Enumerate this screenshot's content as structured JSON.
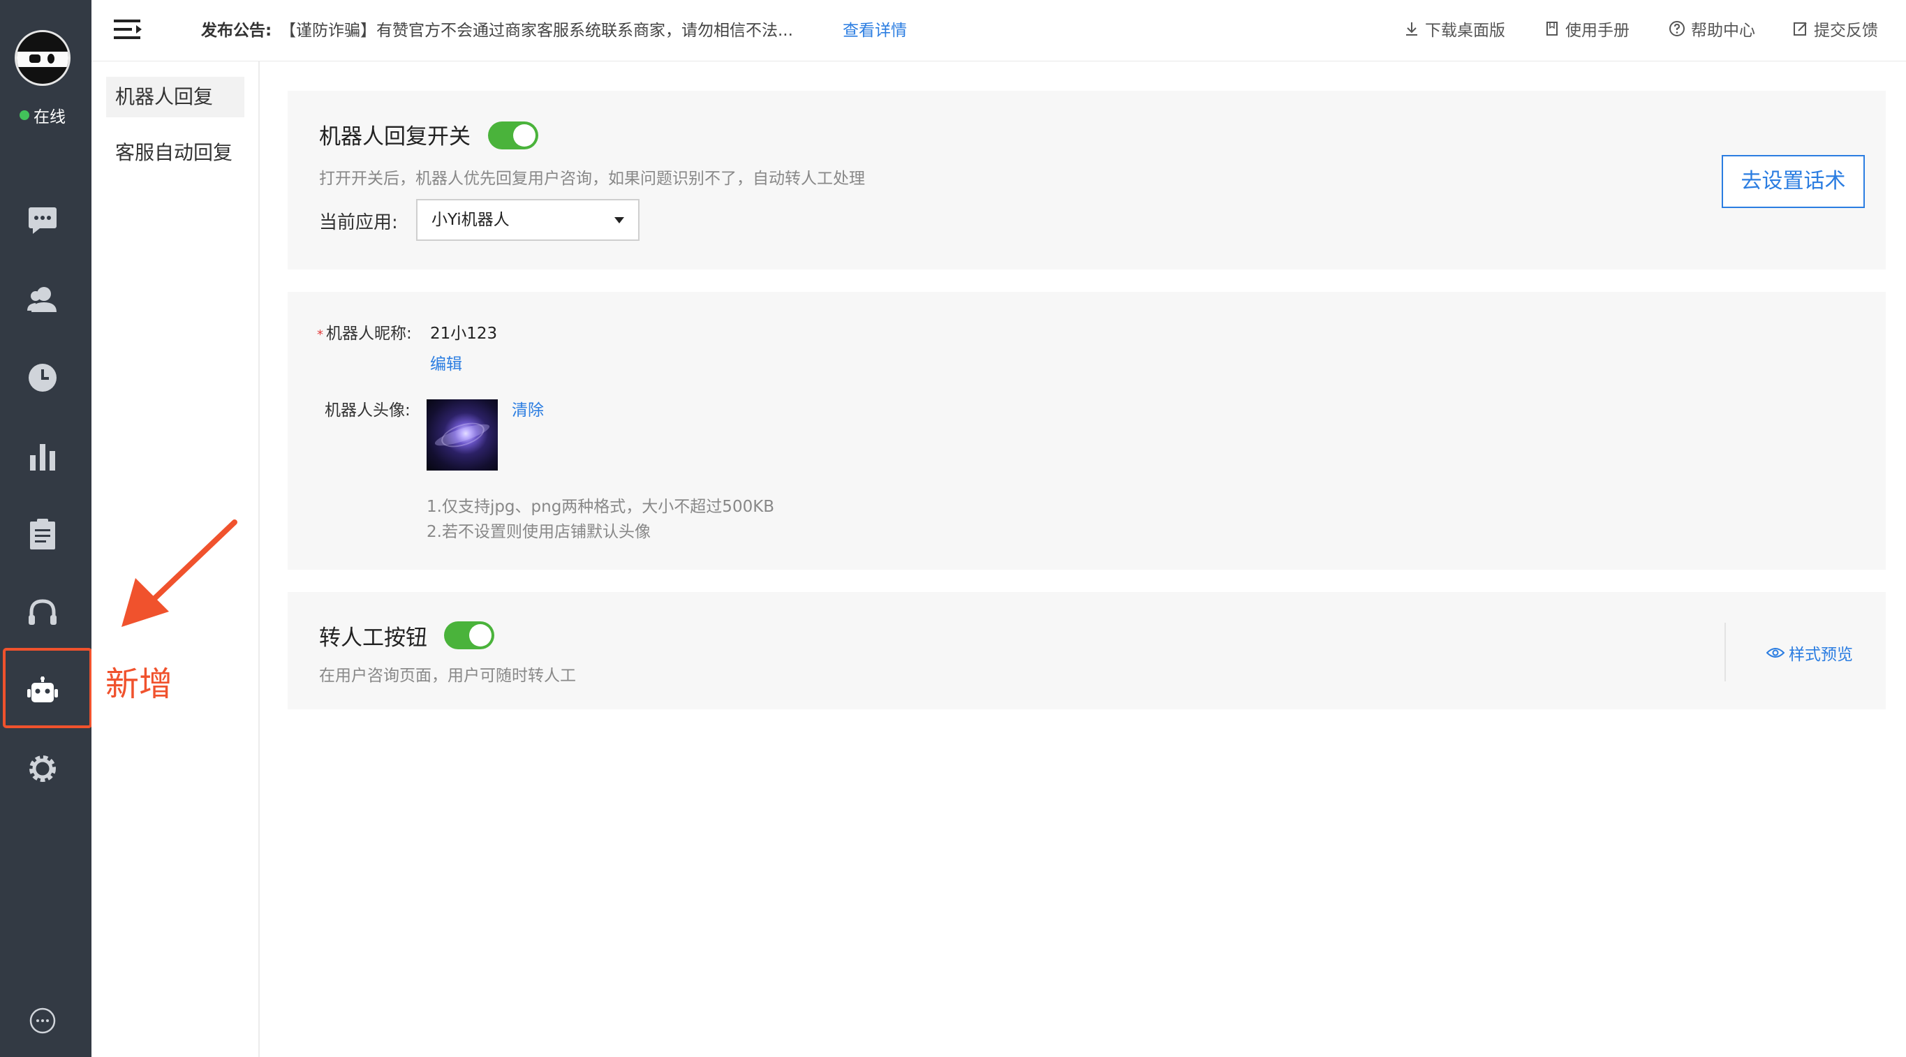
{
  "sidebar": {
    "status": "在线",
    "icons": [
      {
        "name": "chat-icon"
      },
      {
        "name": "customer-icon"
      },
      {
        "name": "history-clock-icon"
      },
      {
        "name": "stats-chart-icon"
      },
      {
        "name": "clipboard-icon"
      },
      {
        "name": "headset-icon"
      },
      {
        "name": "robot-icon"
      },
      {
        "name": "settings-gear-icon"
      },
      {
        "name": "more-icon"
      }
    ]
  },
  "topbar": {
    "notice_label": "发布公告:",
    "notice_text": "【谨防诈骗】有赞官方不会通过商家客服系统联系商家，请勿相信不法...",
    "notice_link": "查看详情",
    "actions": {
      "download": "下载桌面版",
      "manual": "使用手册",
      "help": "帮助中心",
      "feedback": "提交反馈"
    }
  },
  "submenu": {
    "items": [
      {
        "label": "机器人回复",
        "active": true
      },
      {
        "label": "客服自动回复",
        "active": false
      }
    ]
  },
  "annotation": {
    "new_label": "新增",
    "color": "#f0522d"
  },
  "panel_switch": {
    "title": "机器人回复开关",
    "enabled": true,
    "description": "打开开关后，机器人优先回复用户咨询，如果问题识别不了，自动转人工处理",
    "app_label": "当前应用:",
    "app_selected": "小Yi机器人",
    "setup_button": "去设置话术"
  },
  "panel_profile": {
    "nickname_label": "机器人昵称:",
    "nickname_value": "21小123",
    "edit_link": "编辑",
    "avatar_label": "机器人头像:",
    "clear_link": "清除",
    "hint_1": "1.仅支持jpg、png两种格式，大小不超过500KB",
    "hint_2": "2.若不设置则使用店铺默认头像"
  },
  "panel_transfer": {
    "title": "转人工按钮",
    "enabled": true,
    "description": "在用户咨询页面，用户可随时转人工",
    "preview_link": "样式预览"
  },
  "colors": {
    "rail": "#333a44",
    "accent_blue": "#2b7de1",
    "toggle_green": "#4ab33b",
    "online_green": "#42c25a"
  }
}
